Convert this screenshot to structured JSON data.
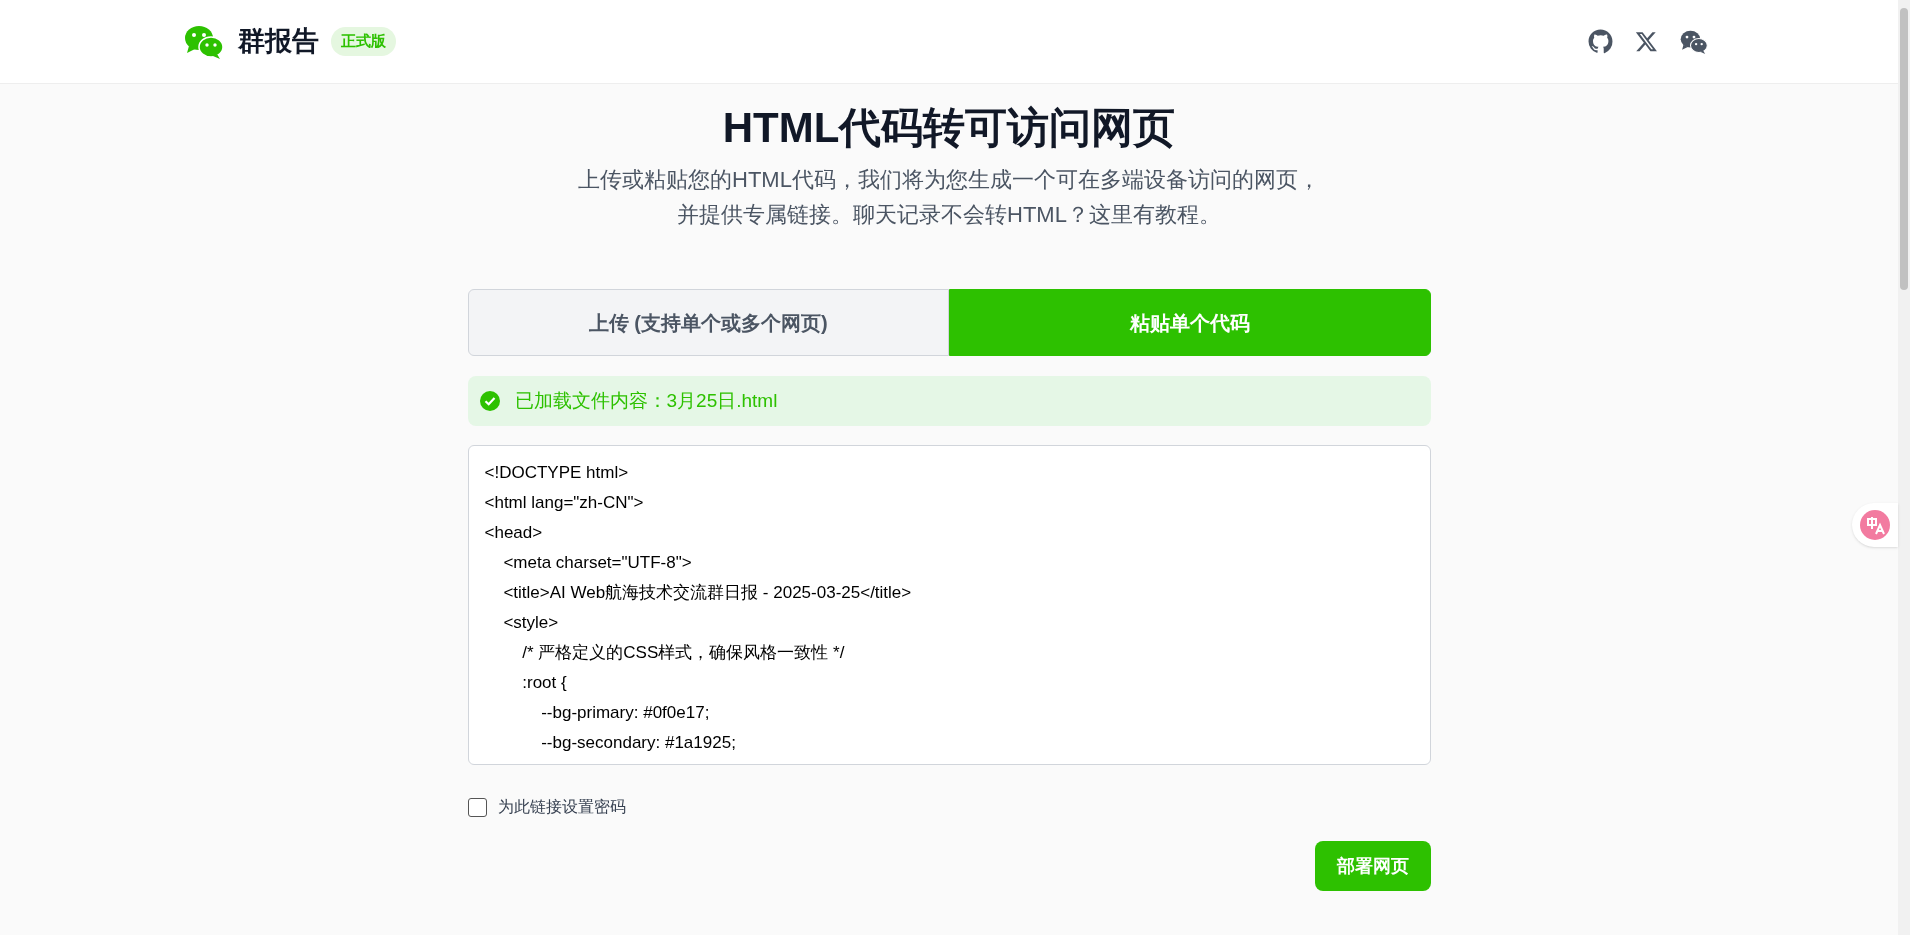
{
  "header": {
    "brand": "群报告",
    "badge": "正式版"
  },
  "hero": {
    "title": "HTML代码转可访问网页",
    "subtitle": "上传或粘贴您的HTML代码，我们将为您生成一个可在多端设备访问的网页，并提供专属链接。聊天记录不会转HTML？这里有教程。"
  },
  "tabs": [
    {
      "label": "上传 (支持单个或多个网页)",
      "selected": false
    },
    {
      "label": "粘贴单个代码",
      "selected": true
    }
  ],
  "notice": {
    "text": "已加载文件内容：3月25日.html"
  },
  "code_field": {
    "lines": [
      "<!DOCTYPE html>",
      "<html lang=\"zh-CN\">",
      "<head>",
      "    <meta charset=\"UTF-8\">",
      "    <title>AI Web航海技术交流群日报 - 2025-03-25</title>",
      "    <style>",
      "        /* 严格定义的CSS样式，确保风格一致性 */",
      "        :root {",
      "            --bg-primary: #0f0e17;",
      "            --bg-secondary: #1a1925;"
    ]
  },
  "password_option": {
    "label": "为此链接设置密码",
    "checked": false
  },
  "deploy_button": {
    "label": "部署网页"
  }
}
